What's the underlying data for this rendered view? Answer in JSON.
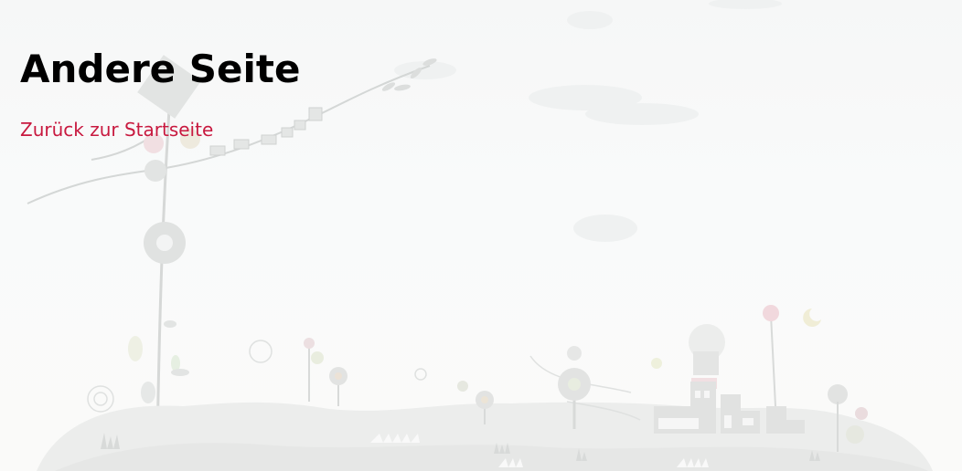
{
  "page": {
    "heading": "Andere Seite",
    "back_link": "Zurück zur Startseite"
  },
  "colors": {
    "link": "#c8193f",
    "heading": "#000000",
    "illustration": "#d9dbd9"
  }
}
